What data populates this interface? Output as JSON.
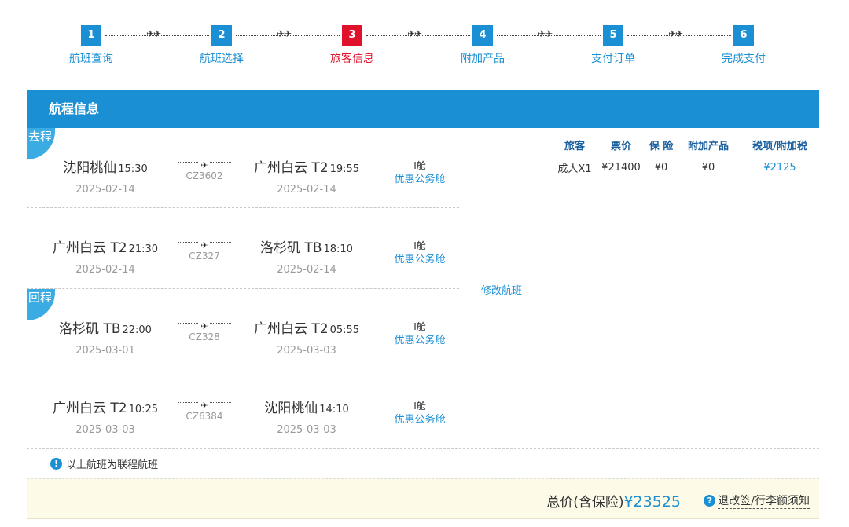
{
  "steps": [
    {
      "num": "1",
      "label": "航班查询"
    },
    {
      "num": "2",
      "label": "航班选择"
    },
    {
      "num": "3",
      "label": "旅客信息"
    },
    {
      "num": "4",
      "label": "附加产品"
    },
    {
      "num": "5",
      "label": "支付订单"
    },
    {
      "num": "6",
      "label": "完成支付"
    }
  ],
  "active_step": 3,
  "connector_arrows": "✈✈",
  "section_title": "航程信息",
  "outbound_badge": "去程",
  "return_badge": "回程",
  "segments": [
    {
      "dep_city": "沈阳桃仙",
      "dep_time": "15:30",
      "dep_date": "2025-02-14",
      "flight_no": "CZ3602",
      "arr_city": "广州白云 T2",
      "arr_time": "19:55",
      "arr_date": "2025-02-14",
      "cabin_class": "I舱",
      "cabin_type": "优惠公务舱"
    },
    {
      "dep_city": "广州白云 T2",
      "dep_time": "21:30",
      "dep_date": "2025-02-14",
      "flight_no": "CZ327",
      "arr_city": "洛杉矶 TB",
      "arr_time": "18:10",
      "arr_date": "2025-02-14",
      "cabin_class": "I舱",
      "cabin_type": "优惠公务舱"
    },
    {
      "dep_city": "洛杉矶 TB",
      "dep_time": "22:00",
      "dep_date": "2025-03-01",
      "flight_no": "CZ328",
      "arr_city": "广州白云 T2",
      "arr_time": "05:55",
      "arr_date": "2025-03-03",
      "cabin_class": "I舱",
      "cabin_type": "优惠公务舱"
    },
    {
      "dep_city": "广州白云 T2",
      "dep_time": "10:25",
      "dep_date": "2025-03-03",
      "flight_no": "CZ6384",
      "arr_city": "沈阳桃仙",
      "arr_time": "14:10",
      "arr_date": "2025-03-03",
      "cabin_class": "I舱",
      "cabin_type": "优惠公务舱"
    }
  ],
  "modify_flight": "修改航班",
  "price_table": {
    "headers": [
      "旅客",
      "票价",
      "保 险",
      "附加产品",
      "税项/附加税"
    ],
    "rows": [
      [
        "成人X1",
        "¥21400",
        "¥0",
        "¥0",
        "¥2125"
      ]
    ]
  },
  "note": "以上航班为联程航班",
  "note_icon": "!",
  "total_label": "总价(含保险)",
  "total_amount": "¥23525",
  "help_icon": "?",
  "rules_link": "退改签/行李额须知",
  "colors": {
    "accent": "#1a8fd4",
    "active": "#e0112b",
    "badge": "#3aabe3",
    "footer_bg": "#fdfbe8"
  }
}
